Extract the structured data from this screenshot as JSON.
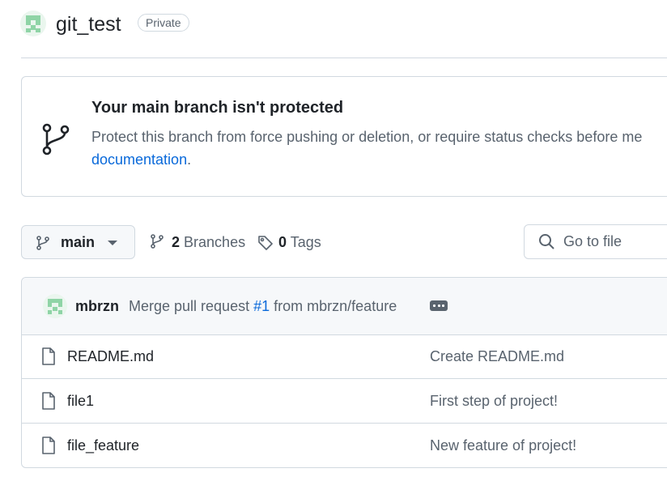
{
  "repo": {
    "name": "git_test",
    "visibility": "Private",
    "avatar_icon": "identicon-avatar"
  },
  "banner": {
    "icon": "git-branch-icon",
    "title": "Your main branch isn't protected",
    "description": "Protect this branch from force pushing or deletion, or require status checks before me",
    "link_text": "documentation",
    "trailing": "."
  },
  "branch_bar": {
    "current_branch": "main",
    "branches_count": "2",
    "branches_label": "Branches",
    "tags_count": "0",
    "tags_label": "Tags",
    "search_placeholder": "Go to file"
  },
  "latest_commit": {
    "author": "mbrzn",
    "message_prefix": "Merge pull request",
    "pr_ref": "#1",
    "message_suffix": "from mbrzn/feature"
  },
  "files": [
    {
      "name": "README.md",
      "last_commit": "Create README.md",
      "icon": "file-icon"
    },
    {
      "name": "file1",
      "last_commit": "First step of project!",
      "icon": "file-icon"
    },
    {
      "name": "file_feature",
      "last_commit": "New feature of project!",
      "icon": "file-icon"
    }
  ],
  "colors": {
    "accent_link": "#0969da",
    "border": "#d1d9e0",
    "muted_text": "#59636e",
    "avatar_green": "#8fd4a6"
  }
}
